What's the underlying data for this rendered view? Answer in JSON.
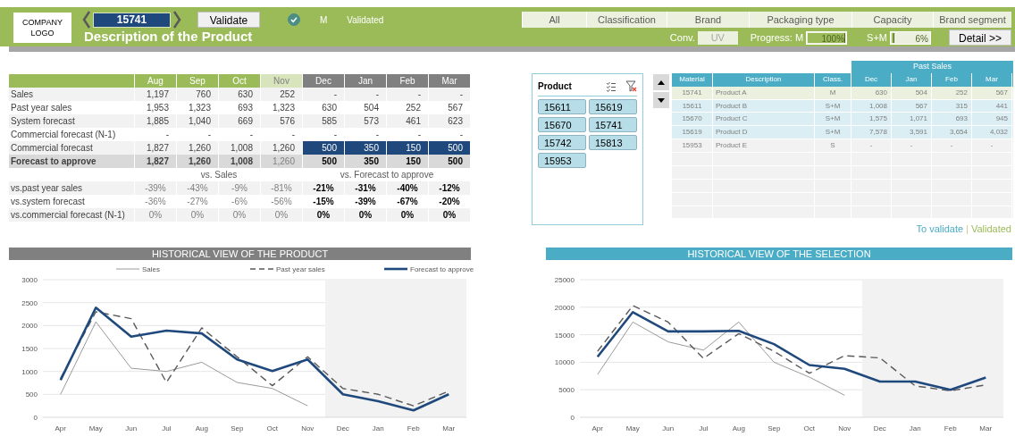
{
  "header": {
    "logo": "COMPANY LOGO",
    "product_code": "15741",
    "validate_button": "Validate",
    "validated": true,
    "class": "M",
    "status_text": "Validated",
    "title": "Description of the Product"
  },
  "filters": [
    "All",
    "Classification",
    "Brand",
    "Packaging type",
    "Capacity",
    "Brand segment"
  ],
  "conv": {
    "label": "Conv.",
    "value": "UV"
  },
  "progress": [
    {
      "label": "Progress: M",
      "level": 1,
      "reading": "100%"
    },
    {
      "label": "S+M",
      "level": 0.06,
      "reading": "6%"
    }
  ],
  "detail_button": "Detail >>",
  "forecast_table": {
    "columns": [
      {
        "label": "Aug",
        "kind": "actual"
      },
      {
        "label": "Sep",
        "kind": "actual"
      },
      {
        "label": "Oct",
        "kind": "actual"
      },
      {
        "label": "Nov",
        "kind": "current"
      },
      {
        "label": "Dec",
        "kind": "forecast"
      },
      {
        "label": "Jan",
        "kind": "forecast"
      },
      {
        "label": "Feb",
        "kind": "forecast"
      },
      {
        "label": "Mar",
        "kind": "forecast"
      }
    ],
    "rows": [
      {
        "label": "Sales",
        "kind": "plain",
        "cells": [
          "1,197",
          "760",
          "630",
          "252",
          "-",
          "-",
          "-",
          "-"
        ]
      },
      {
        "label": "Past year sales",
        "kind": "plain",
        "cells": [
          "1,953",
          "1,323",
          "693",
          "1,323",
          "630",
          "504",
          "252",
          "567"
        ]
      },
      {
        "label": "System forecast",
        "kind": "plain",
        "cells": [
          "1,885",
          "1,040",
          "669",
          "576",
          "585",
          "573",
          "461",
          "623"
        ]
      },
      {
        "label": "Commercial forecast (N-1)",
        "kind": "plain",
        "cells": [
          "-",
          "-",
          "-",
          "-",
          "-",
          "-",
          "-",
          "-"
        ]
      },
      {
        "label": "Commercial forecast",
        "kind": "input",
        "cells": [
          "1,827",
          "1,260",
          "1,008",
          "1,260",
          "500",
          "350",
          "150",
          "500"
        ]
      },
      {
        "label": "Forecast to approve",
        "kind": "total",
        "cells": [
          "1,827",
          "1,260",
          "1,008",
          "1,260",
          "500",
          "350",
          "150",
          "500"
        ]
      }
    ],
    "compare_headers": [
      "vs. Sales",
      "vs. Forecast to approve"
    ],
    "compare_rows": [
      {
        "label": "vs.past year sales",
        "cells": [
          "-39%",
          "-43%",
          "-9%",
          "-81%",
          "-21%",
          "-31%",
          "-40%",
          "-12%"
        ]
      },
      {
        "label": "vs.system forecast",
        "cells": [
          "-36%",
          "-27%",
          "-6%",
          "-56%",
          "-15%",
          "-39%",
          "-67%",
          "-20%"
        ]
      },
      {
        "label": "vs.commercial forecast (N-1)",
        "cells": [
          "0%",
          "0%",
          "0%",
          "0%",
          "0%",
          "0%",
          "0%",
          "0%"
        ]
      }
    ]
  },
  "slicer": {
    "title": "Product",
    "items": [
      {
        "label": "15611",
        "selected": true
      },
      {
        "label": "15619",
        "selected": true
      },
      {
        "label": "15670",
        "selected": true
      },
      {
        "label": "15741",
        "selected": true
      },
      {
        "label": "15742",
        "selected": true
      },
      {
        "label": "15813",
        "selected": true
      },
      {
        "label": "15953",
        "selected": true
      }
    ]
  },
  "material_table": {
    "group_header": "Past Sales",
    "columns": [
      "Material",
      "Description",
      "Class.",
      "Dec",
      "Jan",
      "Feb",
      "Mar"
    ],
    "rows": [
      {
        "color": "#ebf1de",
        "cells": [
          "15741",
          "Product A",
          "M",
          "630",
          "504",
          "252",
          "567"
        ]
      },
      {
        "color": "#daeef3",
        "cells": [
          "15611",
          "Product B",
          "S+M",
          "1,008",
          "567",
          "315",
          "441"
        ]
      },
      {
        "color": "#daeef3",
        "cells": [
          "15670",
          "Product C",
          "S+M",
          "1,575",
          "1,071",
          "693",
          "945"
        ]
      },
      {
        "color": "#daeef3",
        "cells": [
          "15619",
          "Product D",
          "S+M",
          "7,578",
          "3,591",
          "3,654",
          "4,032"
        ]
      },
      {
        "color": "#f2f2f2",
        "cells": [
          "15953",
          "Product E",
          "S",
          "-",
          "-",
          "-",
          "-"
        ]
      }
    ]
  },
  "status_legend": {
    "items": [
      {
        "label": "To validate",
        "color": "#4bacc6"
      },
      {
        "label": "Validated",
        "color": "#9bbb59"
      }
    ],
    "separator": "|"
  },
  "views": [
    {
      "title": "HISTORICAL VIEW OF THE PRODUCT",
      "color": "#808080",
      "chart_data": {
        "type": "line",
        "legend": "top",
        "categories": [
          "Apr",
          "May",
          "Jun",
          "Jul",
          "Aug",
          "Sep",
          "Oct",
          "Nov",
          "Dec",
          "Jan",
          "Feb",
          "Mar"
        ],
        "ylim": [
          0,
          3000
        ],
        "grid": "y",
        "yticks": [
          0,
          500,
          1000,
          1500,
          2000,
          2500,
          3000
        ],
        "series": [
          {
            "name": "Sales",
            "color": "#808080",
            "line_style": "solid",
            "values": [
              500,
              2080,
              1070,
              1000,
              1200,
              760,
              630,
              250,
              null,
              null,
              null,
              null
            ]
          },
          {
            "name": "Past year sales",
            "color": "#595959",
            "line_style": "dashed",
            "values": [
              850,
              2300,
              2150,
              760,
              1950,
              1320,
              690,
              1320,
              630,
              500,
              250,
              570
            ]
          },
          {
            "name": "Forecast to approve",
            "color": "#1f497d",
            "line_style": "solid",
            "values": [
              810,
              2390,
              1760,
              1890,
              1830,
              1260,
              1010,
              1260,
              500,
              350,
              150,
              500
            ]
          }
        ],
        "bands": [
          {
            "axis": "x",
            "from": "Dec",
            "to": "Mar",
            "color": "#f2f2f2"
          }
        ]
      }
    },
    {
      "title": "HISTORICAL VIEW OF THE SELECTION",
      "color": "#4bacc6",
      "chart_data": {
        "type": "line",
        "categories": [
          "Apr",
          "May",
          "Jun",
          "Jul",
          "Aug",
          "Sep",
          "Oct",
          "Nov",
          "Dec",
          "Jan",
          "Feb",
          "Mar"
        ],
        "ylim": [
          0,
          25000
        ],
        "grid": "y",
        "yticks": [
          0,
          5000,
          10000,
          15000,
          20000,
          25000
        ],
        "series": [
          {
            "color": "#808080",
            "line_style": "solid",
            "values": [
              7800,
              17300,
              13700,
              12200,
              17300,
              10000,
              7300,
              4000,
              null,
              null,
              null,
              null
            ]
          },
          {
            "color": "#595959",
            "line_style": "dashed",
            "values": [
              12000,
              20300,
              17300,
              10700,
              15200,
              12000,
              8000,
              11200,
              10800,
              5700,
              4800,
              5900
            ]
          },
          {
            "color": "#1f497d",
            "line_style": "solid",
            "values": [
              11000,
              19100,
              15600,
              15600,
              15700,
              13300,
              9500,
              8800,
              6500,
              6500,
              5000,
              7200
            ]
          }
        ],
        "bands": [
          {
            "axis": "x",
            "from": "Dec",
            "to": "Mar",
            "color": "#f2f2f2"
          }
        ]
      }
    }
  ]
}
